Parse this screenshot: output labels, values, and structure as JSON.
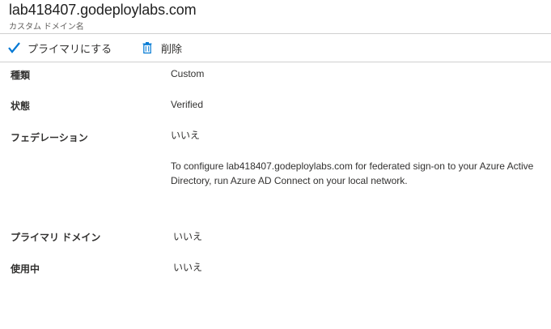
{
  "header": {
    "title": "lab418407.godeploylabs.com",
    "subtitle": "カスタム ドメイン名"
  },
  "toolbar": {
    "make_primary_label": "プライマリにする",
    "make_primary_icon": "checkmark-icon",
    "delete_label": "削除",
    "delete_icon": "trash-icon",
    "accent_color": "#0078d4"
  },
  "properties": {
    "type": {
      "label": "種類",
      "value": "Custom"
    },
    "status": {
      "label": "状態",
      "value": "Verified"
    },
    "federation": {
      "label": "フェデレーション",
      "value": "いいえ",
      "note": "To configure lab418407.godeploylabs.com for federated sign-on to your Azure Active Directory, run Azure AD Connect on your local network."
    },
    "primary_domain": {
      "label": "プライマリ ドメイン",
      "value": "いいえ"
    },
    "in_use": {
      "label": "使用中",
      "value": "いいえ"
    }
  }
}
